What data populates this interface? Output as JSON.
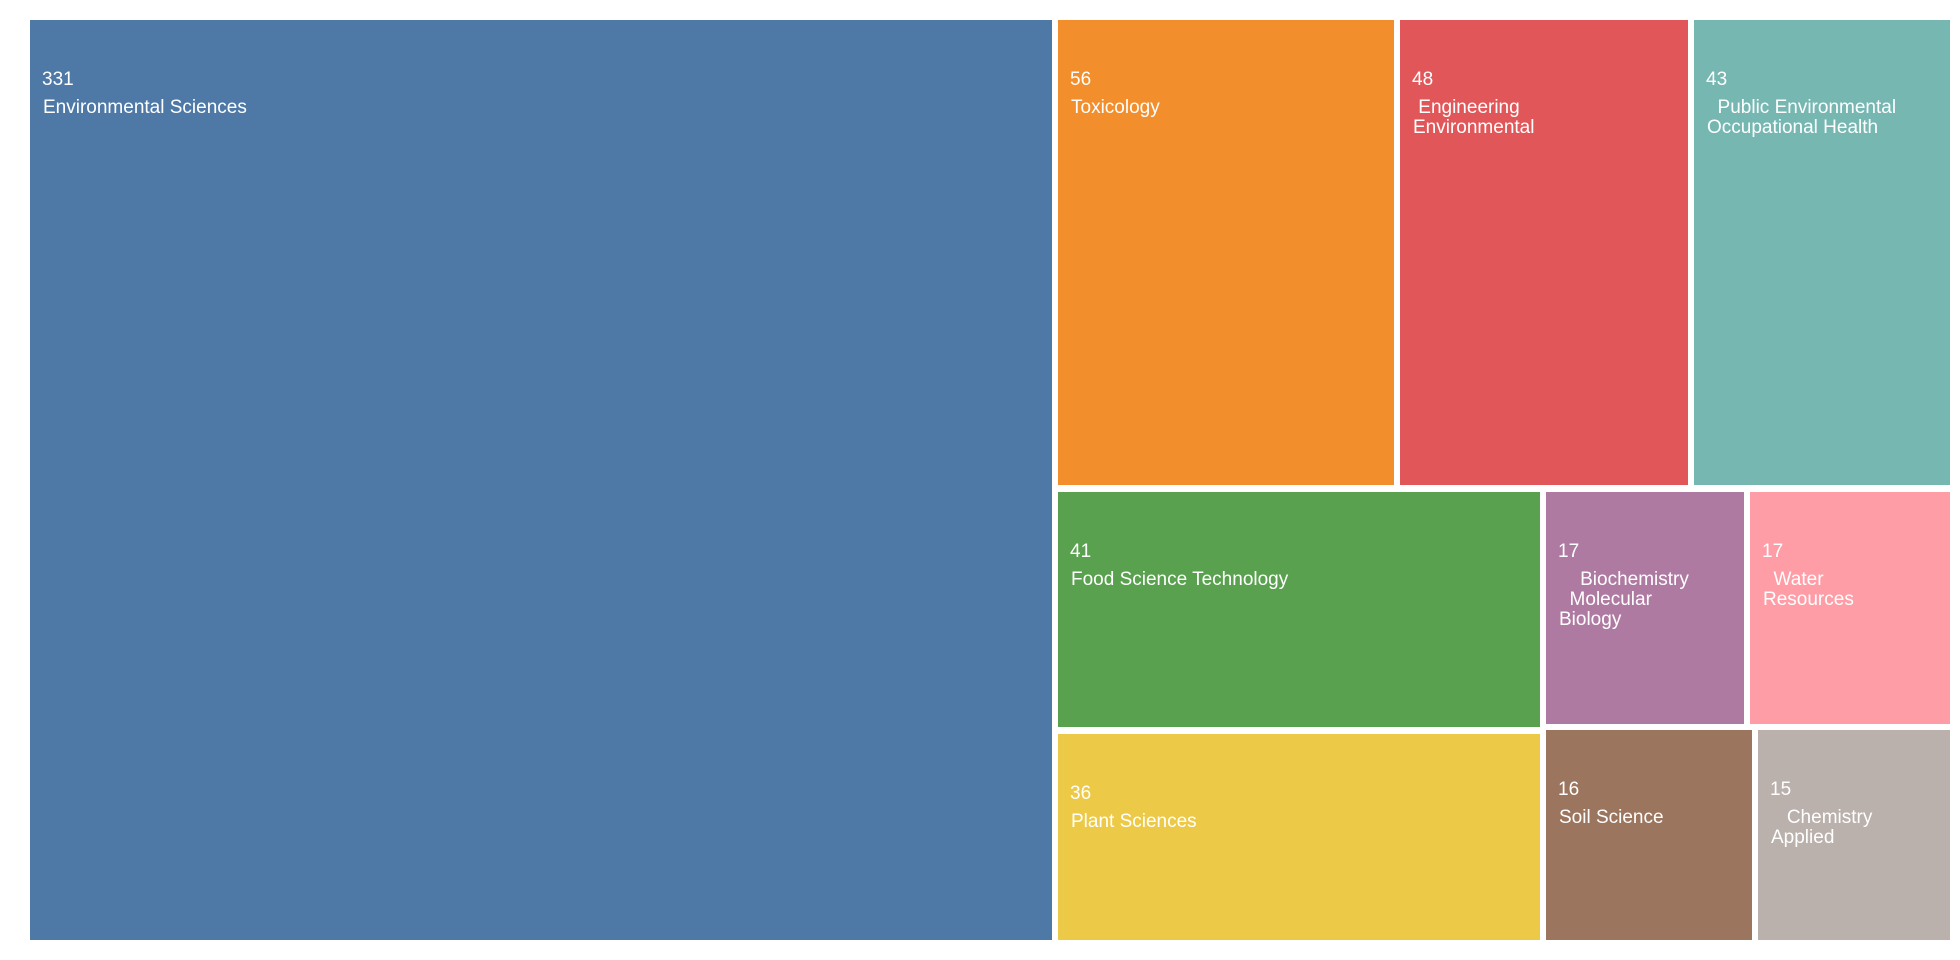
{
  "chart_data": {
    "type": "treemap",
    "title": "",
    "items": [
      {
        "id": "environmental-sciences",
        "value": 331,
        "label": "Environmental Sciences",
        "color": "#4e79a7"
      },
      {
        "id": "toxicology",
        "value": 56,
        "label": "Toxicology",
        "color": "#f28e2b"
      },
      {
        "id": "engineering-environmental",
        "value": 48,
        "label": " Engineering\nEnvironmental",
        "color": "#e15759"
      },
      {
        "id": "public-environmental-occupational-health",
        "value": 43,
        "label": "  Public Environmental\nOccupational Health",
        "color": "#76b7b2"
      },
      {
        "id": "food-science-technology",
        "value": 41,
        "label": "Food Science Technology",
        "color": "#59a14f"
      },
      {
        "id": "biochemistry-molecular-biology",
        "value": 17,
        "label": "    Biochemistry\n  Molecular\nBiology",
        "color": "#af7aa1"
      },
      {
        "id": "water-resources",
        "value": 17,
        "label": "  Water\nResources",
        "color": "#ff9da7"
      },
      {
        "id": "plant-sciences",
        "value": 36,
        "label": "Plant Sciences",
        "color": "#edc948"
      },
      {
        "id": "soil-science",
        "value": 16,
        "label": "Soil Science",
        "color": "#9c755f"
      },
      {
        "id": "chemistry-applied",
        "value": 15,
        "label": "   Chemistry\nApplied",
        "color": "#bab0ac"
      }
    ]
  }
}
